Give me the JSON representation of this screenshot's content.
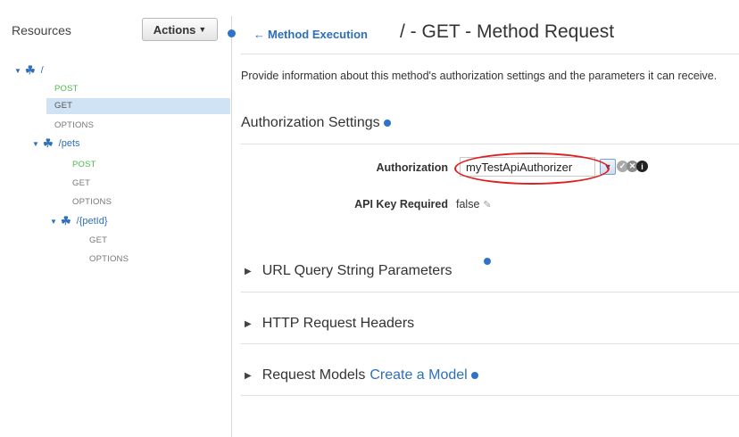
{
  "sidebar": {
    "title": "Resources",
    "actions_label": "Actions",
    "tree": [
      {
        "path": "/",
        "methods": [
          "POST",
          "GET",
          "OPTIONS"
        ]
      },
      {
        "path": "/pets",
        "methods": [
          "POST",
          "GET",
          "OPTIONS"
        ]
      },
      {
        "path": "/{petId}",
        "methods": [
          "GET",
          "OPTIONS"
        ]
      }
    ]
  },
  "header": {
    "back_label": "Method Execution",
    "title": "/ - GET - Method Request"
  },
  "main": {
    "description": "Provide information about this method's authorization settings and the parameters it can receive.",
    "auth_section_title": "Authorization Settings",
    "authorization_label": "Authorization",
    "authorization_value": "myTestApiAuthorizer",
    "api_key_label": "API Key Required",
    "api_key_value": "false",
    "sections": {
      "query": "URL Query String Parameters",
      "headers": "HTTP Request Headers",
      "models": "Request Models",
      "create_model": "Create a Model"
    }
  },
  "colors": {
    "accent": "#2d6fba",
    "post": "#4fba4f",
    "selected": "#cfe3f5",
    "highlight": "#e02020"
  },
  "icons": [
    "resource-icon",
    "caret-down-icon",
    "back-arrow-icon",
    "dropdown-caret-icon",
    "ok-icon",
    "clear-icon",
    "info-icon",
    "pencil-icon",
    "expand-triangle-icon"
  ]
}
